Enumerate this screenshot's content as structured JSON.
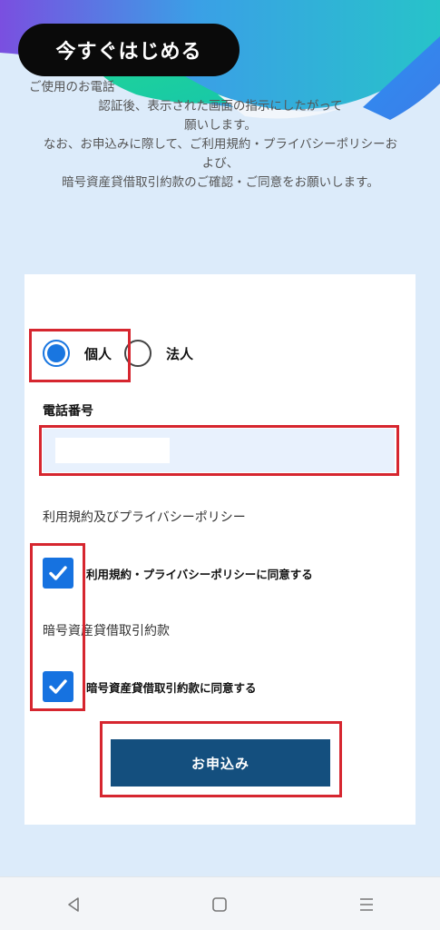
{
  "header": {
    "start_button": "今すぐはじめる"
  },
  "intro": {
    "line1": "ご使用のお電話",
    "line2": "認証後、表示された画面の指示にしたがって",
    "line3": "願いします。",
    "line4": "なお、お申込みに際して、ご利用規約・プライバシーポリシーお",
    "line5": "よび、",
    "line6": "暗号資産貸借取引約款のご確認・ご同意をお願いします。"
  },
  "form": {
    "account_type": {
      "options": [
        "個人",
        "法人"
      ],
      "selected": "個人"
    },
    "phone_label": "電話番号",
    "phone_value": "",
    "terms_section_label": "利用規約及びプライバシーポリシー",
    "terms_checkbox_label": "利用規約・プライバシーポリシーに同意する",
    "terms_checked": true,
    "lending_section_label": "暗号資産貸借取引約款",
    "lending_checkbox_label": "暗号資産貸借取引約款に同意する",
    "lending_checked": true,
    "submit_label": "お申込み"
  },
  "colors": {
    "background": "#dcebfa",
    "accent_blue": "#1672e0",
    "submit_blue": "#144f7e",
    "highlight_red": "#d6262f"
  },
  "navbar": {
    "icons": [
      "back-icon",
      "home-icon",
      "menu-icon"
    ]
  }
}
